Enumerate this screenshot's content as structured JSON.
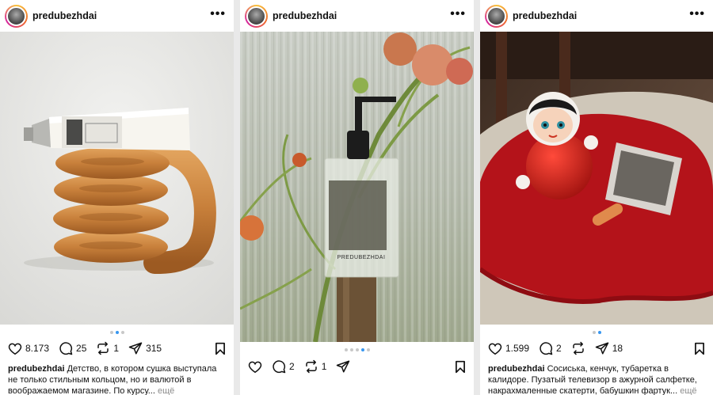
{
  "posts": [
    {
      "username": "predubezhdai",
      "likes": "8.173",
      "comments": "25",
      "reposts": "1",
      "shares": "315",
      "caption_user": "predubezhdai",
      "caption_text": "Детство, в котором сушка выступала не только стильным кольцом, но и валютой в воображаемом магазине. По курсу...",
      "more_label": "ещё",
      "slides": 3,
      "active_slide": 1
    },
    {
      "username": "predubezhdai",
      "comments": "2",
      "reposts": "1",
      "bottle_label": "PREDUBEZHDAI",
      "slides": 5,
      "active_slide": 3
    },
    {
      "username": "predubezhdai",
      "likes": "1.599",
      "comments": "2",
      "shares": "18",
      "caption_user": "predubezhdai",
      "caption_text": "Сосиська, кенчук, тубаретка в калидоре. Пузатый телевизор в ажурной салфетке, накрахмаленные скатерти, бабушкин фартук...",
      "more_label": "ещё",
      "slides": 2,
      "active_slide": 1
    }
  ],
  "icons": [
    "heart-icon",
    "comment-icon",
    "repost-icon",
    "share-icon",
    "bookmark-icon",
    "more-icon"
  ],
  "colors": {
    "active_dot": "#3897f0",
    "inactive_dot": "#c8c8c8",
    "muted_text": "#8e8e8e"
  }
}
